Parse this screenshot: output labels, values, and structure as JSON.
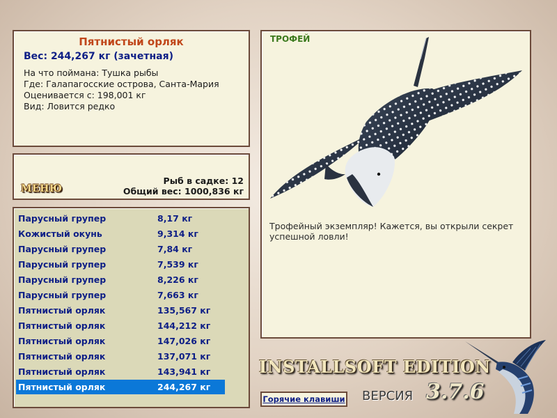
{
  "info": {
    "fish_name": "Пятнистый орляк",
    "weight_line": "Вес: 244,267 кг (зачетная)",
    "caught_on": "На что поймана: Тушка рыбы",
    "location": "Где: Галапагосские острова, Санта-Мария",
    "trophy_from": "Оценивается с: 198,001 кг",
    "rarity": "Вид: Ловится редко"
  },
  "keepnet": {
    "menu_label": "МЕНЮ",
    "fish_count": "Рыб в садке: 12",
    "total_weight": "Общий вес: 1000,836 кг"
  },
  "catch_list": [
    {
      "name": "Парусный групер",
      "weight": "8,17 кг"
    },
    {
      "name": "Кожистый окунь",
      "weight": "9,314 кг"
    },
    {
      "name": "Парусный групер",
      "weight": "7,84 кг"
    },
    {
      "name": "Парусный групер",
      "weight": "7,539 кг"
    },
    {
      "name": "Парусный групер",
      "weight": "8,226 кг"
    },
    {
      "name": "Парусный групер",
      "weight": "7,663 кг"
    },
    {
      "name": "Пятнистый орляк",
      "weight": "135,567 кг"
    },
    {
      "name": "Пятнистый орляк",
      "weight": "144,212 кг"
    },
    {
      "name": "Пятнистый орляк",
      "weight": "147,026 кг"
    },
    {
      "name": "Пятнистый орляк",
      "weight": "137,071 кг"
    },
    {
      "name": "Пятнистый орляк",
      "weight": "143,941 кг"
    },
    {
      "name": "Пятнистый орляк",
      "weight": "244,267 кг"
    }
  ],
  "selected_index": 11,
  "trophy": {
    "label": "ТРОФЕЙ",
    "message": "Трофейный экземпляр! Кажется, вы открыли секрет успешной ловли!"
  },
  "footer": {
    "edition": "INSTALLSOFT EDITION",
    "hotkeys": "Горячие клавиши",
    "version_label": "ВЕРСИЯ",
    "version_number": "3.7.6"
  },
  "icons": {
    "fish_image": "spotted-eagle-ray-image",
    "logo": "marlin-logo-icon"
  },
  "colors": {
    "title_accent": "#c0461a",
    "text_blue": "#0e1f86",
    "selection": "#0b78d8",
    "trophy_label": "#3c7a1e",
    "panel_bg": "#f6f3de",
    "border": "#6b4a3a"
  }
}
